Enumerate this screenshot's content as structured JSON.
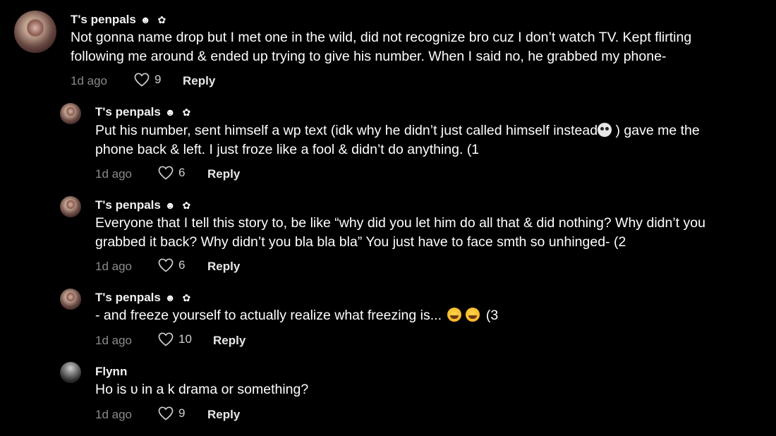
{
  "comments": [
    {
      "username": "T's penpals",
      "badges": "☻ ✿",
      "lines": [
        "Not gonna name drop but I met one in the wild, did not recognize bro cuz I don’t watch TV. Kept flirting",
        "following me around & ended up trying to give his number. When I said no, he grabbed my phone-"
      ],
      "time": "1d ago",
      "likes": "9",
      "reply_label": "Reply"
    },
    {
      "username": "T's penpals",
      "badges": "☻ ✿",
      "line1_before": "Put his number, sent himself a wp text (idk why he didn’t just called himself instead",
      "line1_emoji": "skull-emoji",
      "line1_after": ") gave me the",
      "line2": "phone back & left. I just froze like a fool & didn’t do anything. (1",
      "time": "1d ago",
      "likes": "6",
      "reply_label": "Reply"
    },
    {
      "username": "T's penpals",
      "badges": "☻ ✿",
      "lines": [
        "Everyone that I tell this story to, be like “why did you let him do all that & did nothing? Why didn’t you",
        "grabbed it back? Why didn’t you bla bla bla” You just have to face smth so unhinged- (2"
      ],
      "time": "1d ago",
      "likes": "6",
      "reply_label": "Reply"
    },
    {
      "username": "T's penpals",
      "badges": "☻ ✿",
      "text_before": "- and freeze yourself to actually realize what freezing is...",
      "emoji": "sweat-smile-emoji",
      "text_after": "(3",
      "time": "1d ago",
      "likes": "10",
      "reply_label": "Reply"
    },
    {
      "username": "Flynn",
      "text": "Ho is υ in a k drama or something?",
      "time": "1d ago",
      "likes": "9",
      "reply_label": "Reply"
    }
  ]
}
